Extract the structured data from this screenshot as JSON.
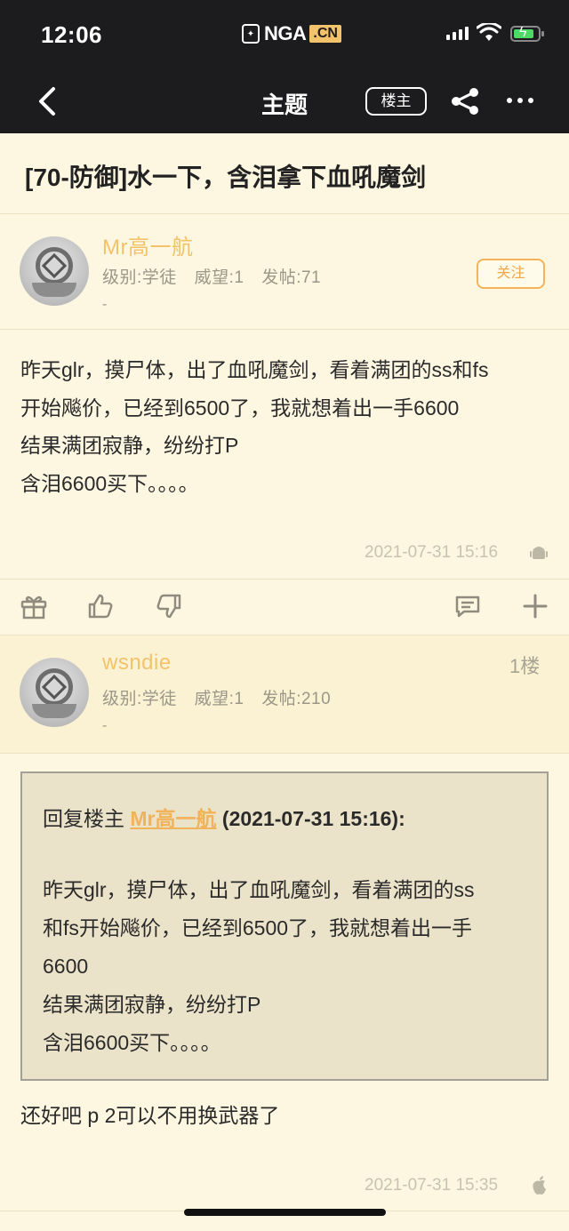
{
  "status_bar": {
    "time": "12:06",
    "logo_text": "NGA",
    "logo_suffix": ".CN"
  },
  "nav": {
    "title": "主题",
    "owner_button": "楼主"
  },
  "topic": {
    "title": "[70-防御]水一下，含泪拿下血吼魔剑"
  },
  "posts": [
    {
      "author": "Mr高一航",
      "level": "级别:学徒",
      "prestige": "威望:1",
      "post_count": "发帖:71",
      "signature": "-",
      "follow_label": "关注",
      "lines": [
        "昨天glr，摸尸体，出了血吼魔剑，看着满团的ss和fs",
        "开始飚价，已经到6500了，我就想着出一手6600",
        "结果满团寂静，纷纷打P",
        "含泪6600买下。。。。"
      ],
      "timestamp": "2021-07-31 15:16",
      "device_icon": "android-icon"
    },
    {
      "author": "wsndie",
      "level": "级别:学徒",
      "prestige": "威望:1",
      "post_count": "发帖:210",
      "signature": "-",
      "floor": "1楼",
      "quote": {
        "prefix": "回复楼主 ",
        "name": "Mr高一航",
        "time": " (2021-07-31 15:16):",
        "lines": [
          "昨天glr，摸尸体，出了血吼魔剑，看着满团的ss",
          "和fs开始飚价，已经到6500了，我就想着出一手",
          "6600",
          "结果满团寂静，纷纷打P",
          "含泪6600买下。。。。"
        ]
      },
      "reply": "还好吧 p 2可以不用换武器了",
      "timestamp": "2021-07-31 15:35",
      "device_icon": "apple-icon"
    }
  ],
  "colors": {
    "accent": "#f2c36a",
    "background": "#fdf7e1",
    "topbar": "#1c1c1e"
  }
}
